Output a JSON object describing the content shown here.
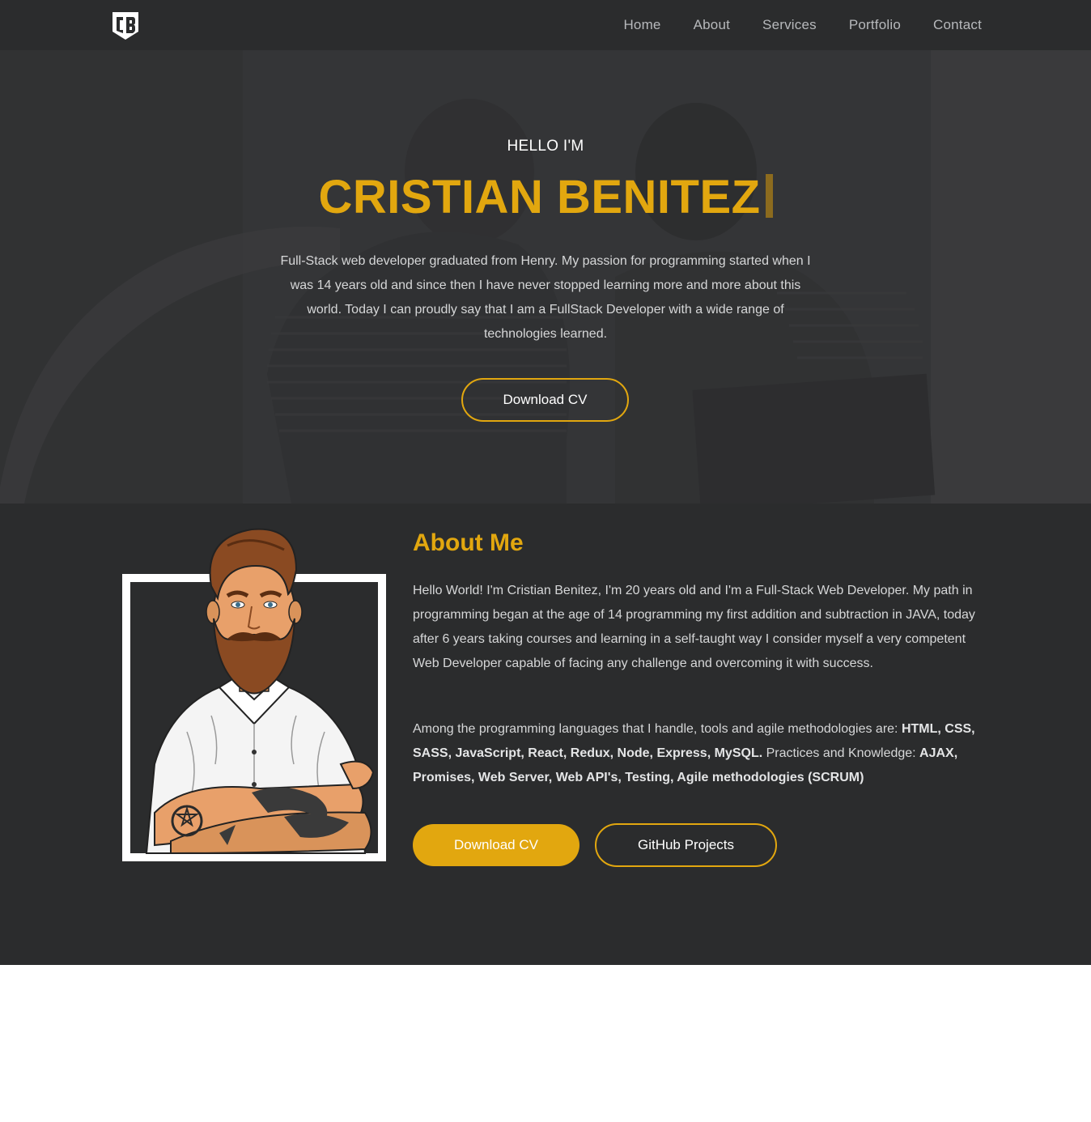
{
  "colors": {
    "accent": "#e2a70f",
    "nav_bg": "#2b2c2d",
    "hero_bg": "#393a3b",
    "text_light": "#d6d7d8"
  },
  "nav": {
    "logo_icon": "cb-shield-logo-icon",
    "links": [
      "Home",
      "About",
      "Services",
      "Portfolio",
      "Contact"
    ]
  },
  "hero": {
    "hello": "HELLO I'M",
    "name": "CRISTIAN BENITEZ",
    "description": "Full-Stack web developer graduated from Henry. My passion for programming started when I was 14 years old and since then I have never stopped learning more and more about this world. Today I can proudly say that I am a FullStack Developer with a wide range of technologies learned.",
    "cta": "Download CV"
  },
  "about": {
    "title": "About Me",
    "paragraph1": "Hello World! I'm Cristian Benitez, I'm 20 years old and I'm a Full-Stack Web Developer. My path in programming began at the age of 14 programming my first addition and subtraction in JAVA, today after 6 years taking courses and learning in a self-taught way I consider myself a very competent Web Developer capable of facing any challenge and overcoming it with success.",
    "paragraph2_intro": "Among the programming languages that I handle, tools and agile methodologies are: ",
    "paragraph2_langs": "HTML, CSS, SASS, JavaScript, React, Redux, Node, Express, MySQL.",
    "paragraph2_mid": " Practices and Knowledge: ",
    "paragraph2_practices": "AJAX, Promises, Web Server, Web API's, Testing, Agile methodologies (SCRUM)",
    "download_label": "Download CV",
    "github_label": "GitHub Projects",
    "portrait_icon": "bearded-man-portrait-icon"
  }
}
